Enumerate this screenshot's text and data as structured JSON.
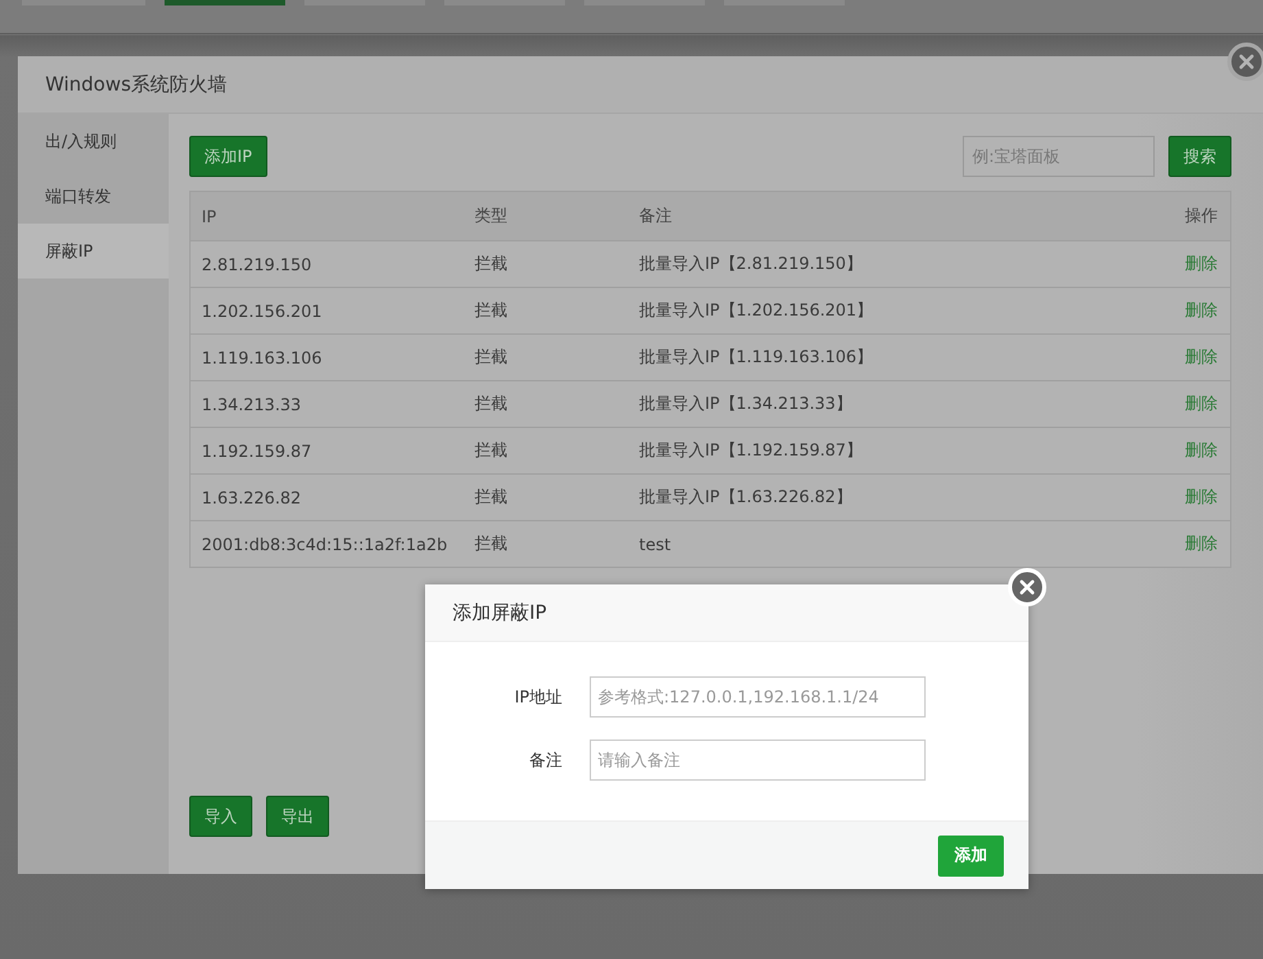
{
  "window": {
    "title": "Windows系统防火墙"
  },
  "sidebar": {
    "items": [
      {
        "label": "出/入规则",
        "selected": false
      },
      {
        "label": "端口转发",
        "selected": false
      },
      {
        "label": "屏蔽IP",
        "selected": true
      }
    ]
  },
  "toolbar": {
    "add_button": "添加IP",
    "search": {
      "placeholder": "例:宝塔面板"
    },
    "search_button": "搜索"
  },
  "table": {
    "columns": [
      "IP",
      "类型",
      "备注",
      "操作"
    ],
    "rows": [
      {
        "ip": "2.81.219.150",
        "type": "拦截",
        "note": "批量导入IP【2.81.219.150】",
        "action": "删除"
      },
      {
        "ip": "1.202.156.201",
        "type": "拦截",
        "note": "批量导入IP【1.202.156.201】",
        "action": "删除"
      },
      {
        "ip": "1.119.163.106",
        "type": "拦截",
        "note": "批量导入IP【1.119.163.106】",
        "action": "删除"
      },
      {
        "ip": "1.34.213.33",
        "type": "拦截",
        "note": "批量导入IP【1.34.213.33】",
        "action": "删除"
      },
      {
        "ip": "1.192.159.87",
        "type": "拦截",
        "note": "批量导入IP【1.192.159.87】",
        "action": "删除"
      },
      {
        "ip": "1.63.226.82",
        "type": "拦截",
        "note": "批量导入IP【1.63.226.82】",
        "action": "删除"
      },
      {
        "ip": "2001:db8:3c4d:15::1a2f:1a2b",
        "type": "拦截",
        "note": "test",
        "action": "删除"
      }
    ]
  },
  "footer_buttons": [
    "导入",
    "导出"
  ],
  "dialog": {
    "title": "添加屏蔽IP",
    "fields": [
      {
        "label": "IP地址",
        "placeholder": "参考格式:127.0.0.1,192.168.1.1/24"
      },
      {
        "label": "备注",
        "placeholder": "请输入备注"
      }
    ],
    "submit_button": "添加"
  }
}
